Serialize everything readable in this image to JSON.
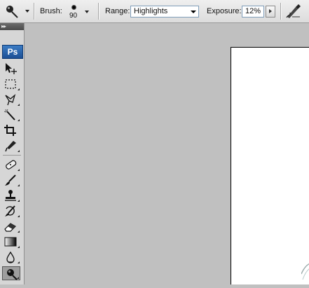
{
  "options_bar": {
    "tool_preset_icon": "dodge-tool-icon",
    "brush_label": "Brush:",
    "brush_size": "90",
    "range_label": "Range:",
    "range_value": "Highlights",
    "exposure_label": "Exposure:",
    "exposure_value": "12%",
    "airbrush_icon": "airbrush-icon"
  },
  "tools_panel": {
    "collapse_glyph": "▸▸",
    "logo_text": "Ps",
    "tools": [
      {
        "name": "move-tool-icon"
      },
      {
        "name": "rectangular-marquee-tool-icon"
      },
      {
        "name": "lasso-tool-icon"
      },
      {
        "name": "magic-wand-tool-icon"
      },
      {
        "name": "crop-tool-icon"
      },
      {
        "name": "slice-tool-icon"
      },
      {
        "name": "healing-brush-tool-icon"
      },
      {
        "name": "brush-tool-icon"
      },
      {
        "name": "clone-stamp-tool-icon"
      },
      {
        "name": "history-brush-tool-icon"
      },
      {
        "name": "eraser-tool-icon"
      },
      {
        "name": "gradient-tool-icon"
      },
      {
        "name": "blur-tool-icon"
      },
      {
        "name": "dodge-tool-icon",
        "active": true
      }
    ]
  },
  "colors": {
    "workspace_bg": "#c0c0c0",
    "panel_bg": "#d6d6d6",
    "ps_logo": "#2a62ad",
    "document_bg": "#ffffff"
  }
}
